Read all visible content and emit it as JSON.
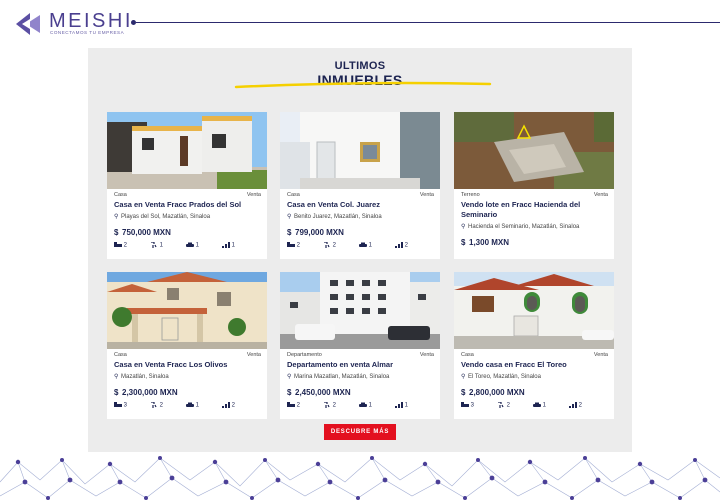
{
  "brand": {
    "name": "MEISHI",
    "tagline": "CONECTAMOS TU EMPRESA",
    "color": "#4a3f8f"
  },
  "section": {
    "title_small": "ULTIMOS",
    "title_big": "INMUEBLES",
    "underline_color": "#f5d000"
  },
  "listings": [
    {
      "type": "Casa",
      "operation": "Venta",
      "title": "Casa en Venta Fracc Prados del Sol",
      "location": "Playas del Sol, Mazatlán, Sinaloa",
      "currency": "$",
      "price": "750,000 MXN",
      "features": {
        "bedrooms": "2",
        "bathrooms": "1",
        "parking": "1",
        "area": "1"
      }
    },
    {
      "type": "Casa",
      "operation": "Venta",
      "title": "Casa en Venta Col. Juarez",
      "location": "Benito Juarez, Mazatlán, Sinaloa",
      "currency": "$",
      "price": "799,000 MXN",
      "features": {
        "bedrooms": "2",
        "bathrooms": "2",
        "parking": "1",
        "area": "2"
      }
    },
    {
      "type": "Terreno",
      "operation": "Venta",
      "title": "Vendo lote en Fracc Hacienda del Seminario",
      "location": "Hacienda el Seminario, Mazatlán, Sinaloa",
      "currency": "$",
      "price": "1,300 MXN",
      "features": {}
    },
    {
      "type": "Casa",
      "operation": "Venta",
      "title": "Casa en Venta Fracc Los Olivos",
      "location": "Mazatlán, Sinaloa",
      "currency": "$",
      "price": "2,300,000 MXN",
      "features": {
        "bedrooms": "3",
        "bathrooms": "2",
        "parking": "1",
        "area": "2"
      }
    },
    {
      "type": "Departamento",
      "operation": "Venta",
      "title": "Departamento en venta Almar",
      "location": "Marina Mazatlan, Mazatlán, Sinaloa",
      "currency": "$",
      "price": "2,450,000 MXN",
      "features": {
        "bedrooms": "2",
        "bathrooms": "2",
        "parking": "1",
        "area": "1"
      }
    },
    {
      "type": "Casa",
      "operation": "Venta",
      "title": "Vendo casa en Fracc El Toreo",
      "location": "El Toreo, Mazatlán, Sinaloa",
      "currency": "$",
      "price": "2,800,000 MXN",
      "features": {
        "bedrooms": "3",
        "bathrooms": "2",
        "parking": "1",
        "area": "2"
      }
    }
  ],
  "cta": {
    "label": "DESCUBRE MÁS",
    "color": "#e3101f"
  },
  "icons": {
    "location": "location-pin-icon",
    "bedrooms": "bed-icon",
    "bathrooms": "shower-icon",
    "parking": "car-icon",
    "area": "area-icon"
  }
}
